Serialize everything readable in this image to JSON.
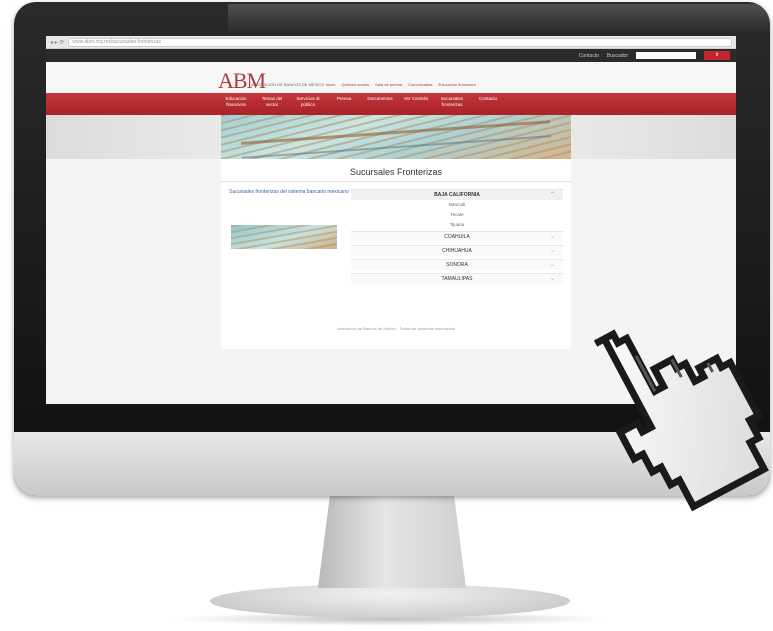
{
  "browser": {
    "nav_glyphs": "◂ ▸ ⟳",
    "url": "www.abm.org.mx/sucursales-fronterizas"
  },
  "topbar": {
    "links": [
      "Contacto",
      "Buscador"
    ],
    "search_placeholder": "",
    "search_button": "Ir"
  },
  "header": {
    "logo_text": "ABM",
    "logo_subtitle": "ASOCIACIÓN DE BANCOS DE MÉXICO",
    "top_links": [
      "Inicio",
      "Quiénes somos",
      "Sala de prensa",
      "Comunicados",
      "Educación financiera"
    ]
  },
  "navbar": {
    "items": [
      "Educación financiera",
      "Temas del sector",
      "Servicios al público",
      "Prensa",
      "Documentos",
      "Ver Comités",
      "Sucursales fronterizas",
      "Contacto"
    ]
  },
  "content": {
    "title": "Sucursales Fronterizas",
    "side_link": "Sucursales fronterizas del sistema bancario mexicano",
    "accordion": [
      {
        "label": "BAJA CALIFORNIA",
        "open": true,
        "sub": [
          "Mexicali",
          "Tecate",
          "Tijuana"
        ]
      },
      {
        "label": "COAHUILA",
        "open": false
      },
      {
        "label": "CHIHUAHUA",
        "open": false
      },
      {
        "label": "SONORA",
        "open": false
      },
      {
        "label": "TAMAULIPAS",
        "open": false
      }
    ],
    "footer_note": "Asociación de Bancos de México · Todos los derechos reservados"
  },
  "colors": {
    "brand_red": "#c0272d",
    "link_blue": "#3a5ea8",
    "monitor_black": "#111111"
  }
}
